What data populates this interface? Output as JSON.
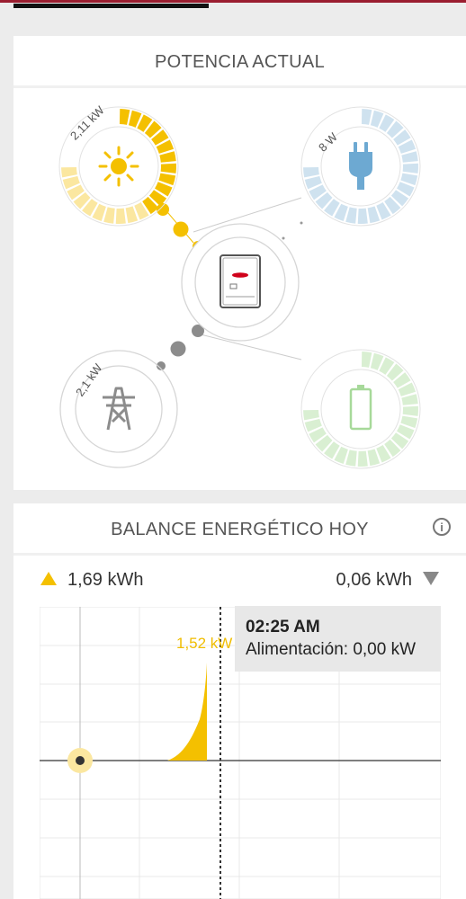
{
  "colors": {
    "accent": "#9a1d2f",
    "solar": "#f4c000",
    "solar_light": "#fbe7a0",
    "consumption": "#6da9d2",
    "consumption_light": "#cfe2ef",
    "battery": "#a7d99a",
    "battery_light": "#d9efd2",
    "grid": "#888888"
  },
  "power": {
    "title": "POTENCIA ACTUAL",
    "solar": {
      "value_label": "2,11 kW",
      "icon": "sun-icon",
      "level": 0.55
    },
    "consumption": {
      "value_label": "8 W",
      "icon": "plug-icon",
      "level": 0.0
    },
    "grid": {
      "value_label": "2,1 kW",
      "icon": "power-tower-icon",
      "level": 0.0
    },
    "battery": {
      "value_label": "",
      "icon": "battery-icon",
      "level": 0.0
    },
    "inverter": {
      "icon": "inverter-icon"
    }
  },
  "balance": {
    "title": "BALANCE ENERGÉTICO HOY",
    "info_icon": "info-icon",
    "produced": "1,69 kWh",
    "fed_in": "0,06 kWh",
    "peak_label": "1,52 kW",
    "tooltip": {
      "time": "02:25 AM",
      "feed_in": "Alimentación: 0,00 kW"
    }
  }
}
